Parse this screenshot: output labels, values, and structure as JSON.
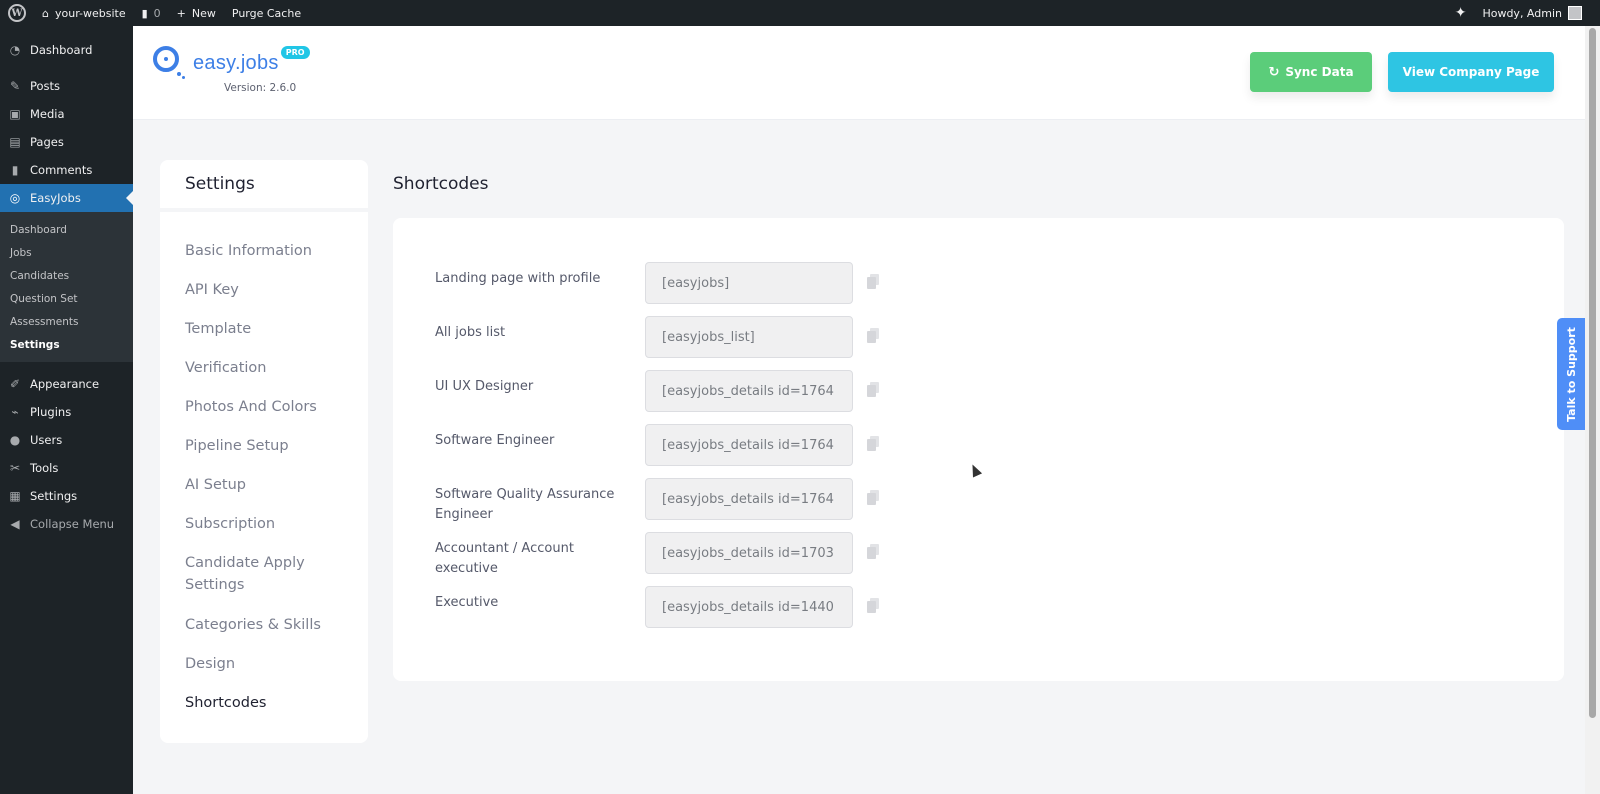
{
  "adminbar": {
    "site_name": "your-website",
    "comments_count": "0",
    "new_label": "New",
    "purge_label": "Purge Cache",
    "howdy": "Howdy, Admin"
  },
  "sidebar": {
    "items_top": [
      {
        "label": "Dashboard",
        "icon": "dashboard-icon"
      },
      {
        "label": "Posts",
        "icon": "pin-icon"
      },
      {
        "label": "Media",
        "icon": "media-icon"
      },
      {
        "label": "Pages",
        "icon": "pages-icon"
      },
      {
        "label": "Comments",
        "icon": "comment-icon"
      }
    ],
    "current": {
      "label": "EasyJobs",
      "icon": "easyjobs-icon"
    },
    "submenu": [
      "Dashboard",
      "Jobs",
      "Candidates",
      "Question Set",
      "Assessments",
      "Settings"
    ],
    "items_bottom": [
      {
        "label": "Appearance",
        "icon": "brush-icon"
      },
      {
        "label": "Plugins",
        "icon": "plug-icon"
      },
      {
        "label": "Users",
        "icon": "user-icon"
      },
      {
        "label": "Tools",
        "icon": "wrench-icon"
      },
      {
        "label": "Settings",
        "icon": "settings-icon"
      }
    ],
    "collapse_label": "Collapse Menu"
  },
  "header": {
    "logo_text": "easy.jobs",
    "pro_badge": "PRO",
    "version": "Version: 2.6.0",
    "sync_label": "Sync Data",
    "view_label": "View Company Page",
    "sync_color": "#5bcd7a",
    "view_color": "#2ec5e3"
  },
  "settings_nav": {
    "title": "Settings",
    "items": [
      "Basic Information",
      "API Key",
      "Template",
      "Verification",
      "Photos And Colors",
      "Pipeline Setup",
      "AI Setup",
      "Subscription",
      "Candidate Apply Settings",
      "Categories & Skills",
      "Design",
      "Shortcodes"
    ],
    "active": "Shortcodes"
  },
  "shortcodes": {
    "title": "Shortcodes",
    "rows": [
      {
        "label": "Landing page with profile",
        "value": "[easyjobs]"
      },
      {
        "label": "All jobs list",
        "value": "[easyjobs_list]"
      },
      {
        "label": "UI UX Designer",
        "value": "[easyjobs_details id=1764"
      },
      {
        "label": "Software Engineer",
        "value": "[easyjobs_details id=1764"
      },
      {
        "label": "Software Quality Assurance Engineer",
        "value": "[easyjobs_details id=1764"
      },
      {
        "label": "Accountant / Account executive",
        "value": "[easyjobs_details id=1703"
      },
      {
        "label": "Executive",
        "value": "[easyjobs_details id=1440"
      }
    ]
  },
  "support": {
    "label": "Talk to Support"
  }
}
